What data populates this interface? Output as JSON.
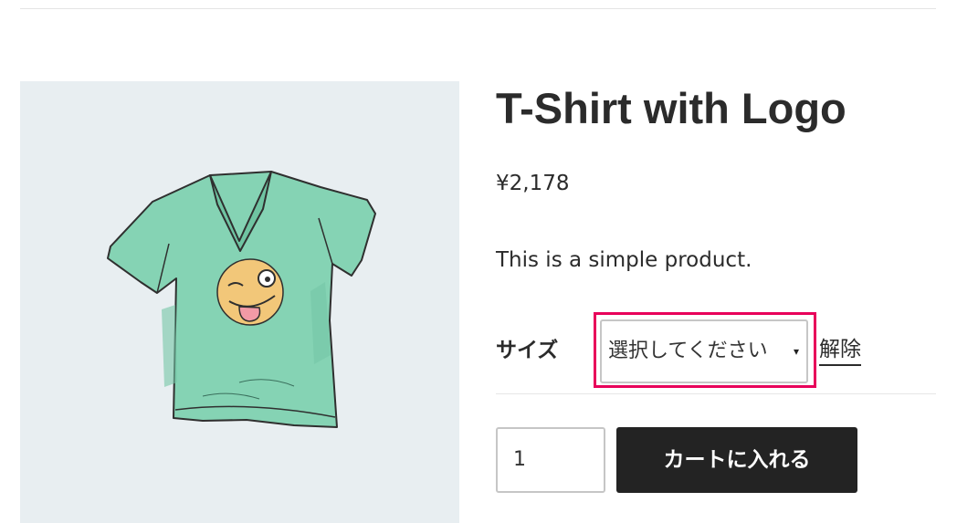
{
  "product": {
    "title": "T-Shirt with Logo",
    "price": "¥2,178",
    "short_description": "This is a simple product.",
    "image": {
      "subject": "tshirt-illustration",
      "background_color": "#e8eef1",
      "shirt_color": "#85d3b4",
      "emoji_color": "#f2c779"
    }
  },
  "variations": {
    "size_label": "サイズ",
    "size_select": {
      "selected": "選択してください",
      "caret": "▾"
    },
    "reset_label": "解除",
    "highlight_color": "#e8005a"
  },
  "cart": {
    "quantity": "1",
    "add_to_cart_label": "カートに入れる",
    "button_color": "#232323"
  }
}
